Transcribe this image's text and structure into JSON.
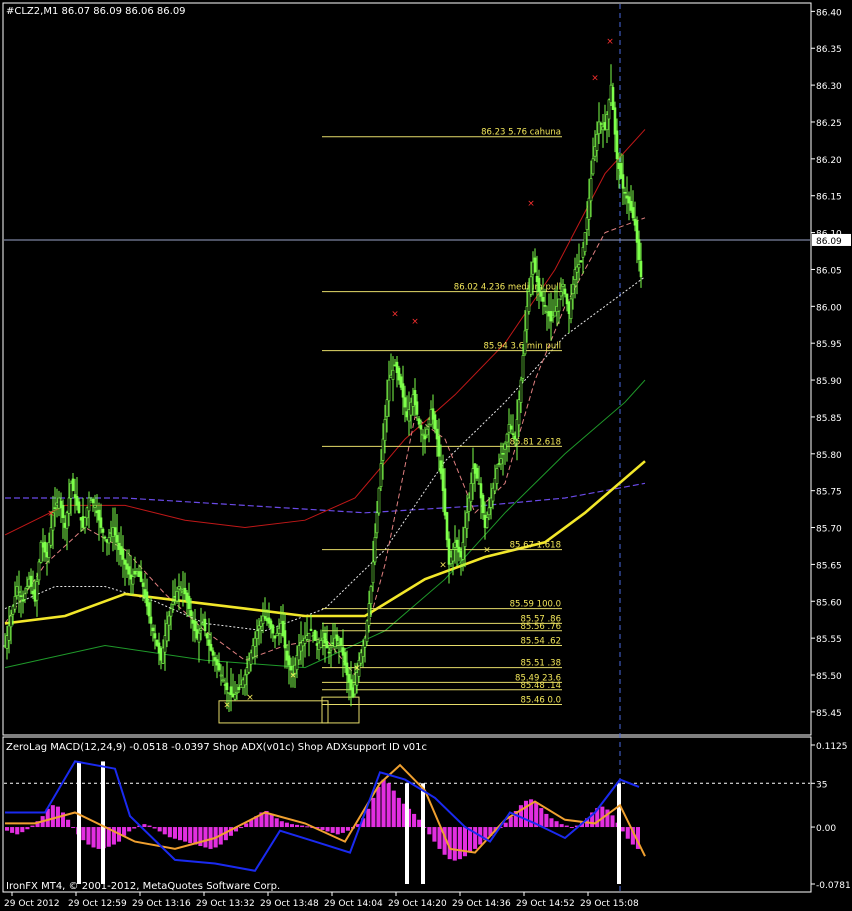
{
  "chart_data": {
    "type": "candlestick",
    "symbol_line": "#CLZ2,M1  86.07 86.09 86.06 86.09",
    "current_price": "86.09",
    "price_axis": {
      "ylim": [
        85.42,
        86.41
      ],
      "ticks": [
        "86.40",
        "86.35",
        "86.30",
        "86.25",
        "86.20",
        "86.15",
        "86.10",
        "86.05",
        "86.00",
        "85.95",
        "85.90",
        "85.85",
        "85.80",
        "85.75",
        "85.70",
        "85.65",
        "85.60",
        "85.55",
        "85.50",
        "85.45"
      ]
    },
    "time_axis": {
      "ticks": [
        "29 Oct 2012",
        "29 Oct 12:59",
        "29 Oct 13:16",
        "29 Oct 13:32",
        "29 Oct 13:48",
        "29 Oct 14:04",
        "29 Oct 14:20",
        "29 Oct 14:36",
        "29 Oct 14:52",
        "29 Oct 15:08"
      ]
    },
    "close_path": [
      [
        0,
        85.54
      ],
      [
        6,
        85.58
      ],
      [
        12,
        85.62
      ],
      [
        18,
        85.6
      ],
      [
        24,
        85.63
      ],
      [
        30,
        85.6
      ],
      [
        36,
        85.68
      ],
      [
        42,
        85.66
      ],
      [
        48,
        85.72
      ],
      [
        54,
        85.74
      ],
      [
        60,
        85.7
      ],
      [
        66,
        85.76
      ],
      [
        72,
        85.73
      ],
      [
        78,
        85.7
      ],
      [
        84,
        85.74
      ],
      [
        90,
        85.73
      ],
      [
        96,
        85.7
      ],
      [
        102,
        85.68
      ],
      [
        108,
        85.7
      ],
      [
        114,
        85.67
      ],
      [
        120,
        85.65
      ],
      [
        126,
        85.63
      ],
      [
        132,
        85.64
      ],
      [
        138,
        85.62
      ],
      [
        144,
        85.58
      ],
      [
        150,
        85.55
      ],
      [
        156,
        85.52
      ],
      [
        162,
        85.57
      ],
      [
        168,
        85.6
      ],
      [
        174,
        85.62
      ],
      [
        180,
        85.61
      ],
      [
        186,
        85.58
      ],
      [
        192,
        85.55
      ],
      [
        198,
        85.57
      ],
      [
        204,
        85.54
      ],
      [
        210,
        85.52
      ],
      [
        216,
        85.5
      ],
      [
        222,
        85.48
      ],
      [
        228,
        85.47
      ],
      [
        234,
        85.48
      ],
      [
        240,
        85.5
      ],
      [
        246,
        85.53
      ],
      [
        252,
        85.56
      ],
      [
        258,
        85.58
      ],
      [
        264,
        85.57
      ],
      [
        270,
        85.55
      ],
      [
        276,
        85.57
      ],
      [
        282,
        85.52
      ],
      [
        288,
        85.5
      ],
      [
        294,
        85.54
      ],
      [
        300,
        85.55
      ],
      [
        306,
        85.56
      ],
      [
        312,
        85.54
      ],
      [
        318,
        85.55
      ],
      [
        324,
        85.53
      ],
      [
        330,
        85.55
      ],
      [
        336,
        85.54
      ],
      [
        342,
        85.5
      ],
      [
        348,
        85.47
      ],
      [
        354,
        85.52
      ],
      [
        360,
        85.55
      ],
      [
        366,
        85.62
      ],
      [
        372,
        85.72
      ],
      [
        378,
        85.82
      ],
      [
        384,
        85.9
      ],
      [
        390,
        85.92
      ],
      [
        396,
        85.89
      ],
      [
        402,
        85.85
      ],
      [
        408,
        85.88
      ],
      [
        414,
        85.84
      ],
      [
        420,
        85.82
      ],
      [
        426,
        85.86
      ],
      [
        432,
        85.82
      ],
      [
        438,
        85.75
      ],
      [
        444,
        85.65
      ],
      [
        450,
        85.68
      ],
      [
        456,
        85.66
      ],
      [
        462,
        85.72
      ],
      [
        468,
        85.78
      ],
      [
        474,
        85.76
      ],
      [
        480,
        85.7
      ],
      [
        486,
        85.74
      ],
      [
        492,
        85.78
      ],
      [
        498,
        85.8
      ],
      [
        504,
        85.84
      ],
      [
        510,
        85.82
      ],
      [
        516,
        85.9
      ],
      [
        522,
        86.0
      ],
      [
        528,
        86.06
      ],
      [
        534,
        86.02
      ],
      [
        540,
        86.0
      ],
      [
        546,
        85.98
      ],
      [
        552,
        86.0
      ],
      [
        558,
        86.03
      ],
      [
        564,
        85.99
      ],
      [
        570,
        86.05
      ],
      [
        576,
        86.06
      ],
      [
        582,
        86.12
      ],
      [
        588,
        86.2
      ],
      [
        594,
        86.25
      ],
      [
        600,
        86.24
      ],
      [
        606,
        86.3
      ],
      [
        612,
        86.2
      ],
      [
        618,
        86.16
      ],
      [
        624,
        86.14
      ],
      [
        630,
        86.11
      ],
      [
        636,
        86.04
      ],
      [
        640,
        86.09
      ]
    ],
    "indicators": {
      "yellow_ma": [
        [
          0,
          85.57
        ],
        [
          60,
          85.58
        ],
        [
          120,
          85.61
        ],
        [
          180,
          85.6
        ],
        [
          240,
          85.59
        ],
        [
          300,
          85.58
        ],
        [
          360,
          85.58
        ],
        [
          420,
          85.63
        ],
        [
          480,
          85.66
        ],
        [
          540,
          85.68
        ],
        [
          580,
          85.72
        ],
        [
          640,
          85.79
        ]
      ],
      "purple_ma": [
        [
          0,
          85.74
        ],
        [
          120,
          85.74
        ],
        [
          240,
          85.73
        ],
        [
          360,
          85.72
        ],
        [
          480,
          85.73
        ],
        [
          560,
          85.74
        ],
        [
          640,
          85.76
        ]
      ],
      "red_ma": [
        [
          0,
          85.69
        ],
        [
          60,
          85.73
        ],
        [
          120,
          85.73
        ],
        [
          180,
          85.71
        ],
        [
          240,
          85.7
        ],
        [
          300,
          85.71
        ],
        [
          350,
          85.74
        ],
        [
          400,
          85.82
        ],
        [
          450,
          85.88
        ],
        [
          500,
          85.95
        ],
        [
          550,
          86.05
        ],
        [
          600,
          86.18
        ],
        [
          640,
          86.24
        ]
      ],
      "green_ma": [
        [
          0,
          85.51
        ],
        [
          100,
          85.54
        ],
        [
          200,
          85.52
        ],
        [
          300,
          85.51
        ],
        [
          380,
          85.56
        ],
        [
          440,
          85.63
        ],
        [
          500,
          85.72
        ],
        [
          560,
          85.8
        ],
        [
          620,
          85.87
        ],
        [
          640,
          85.9
        ]
      ],
      "white_dash_ma": [
        [
          0,
          85.59
        ],
        [
          50,
          85.62
        ],
        [
          100,
          85.62
        ],
        [
          150,
          85.6
        ],
        [
          200,
          85.57
        ],
        [
          260,
          85.56
        ],
        [
          320,
          85.59
        ],
        [
          380,
          85.67
        ],
        [
          440,
          85.79
        ],
        [
          500,
          85.87
        ],
        [
          560,
          85.96
        ],
        [
          640,
          86.04
        ]
      ],
      "pink_dash_ma": [
        [
          0,
          85.57
        ],
        [
          40,
          85.65
        ],
        [
          80,
          85.7
        ],
        [
          120,
          85.67
        ],
        [
          160,
          85.61
        ],
        [
          200,
          85.56
        ],
        [
          240,
          85.52
        ],
        [
          280,
          85.54
        ],
        [
          320,
          85.55
        ],
        [
          350,
          85.5
        ],
        [
          380,
          85.65
        ],
        [
          410,
          85.85
        ],
        [
          440,
          85.82
        ],
        [
          470,
          85.72
        ],
        [
          500,
          85.76
        ],
        [
          530,
          85.9
        ],
        [
          560,
          86.0
        ],
        [
          600,
          86.1
        ],
        [
          640,
          86.12
        ]
      ]
    },
    "red_markers": [
      [
        46,
        85.72
      ],
      [
        390,
        85.99
      ],
      [
        410,
        85.98
      ],
      [
        526,
        86.14
      ],
      [
        590,
        86.31
      ],
      [
        605,
        86.36
      ]
    ],
    "yellow_markers": [
      [
        222,
        85.46
      ],
      [
        245,
        85.47
      ],
      [
        288,
        85.5
      ],
      [
        352,
        85.51
      ],
      [
        438,
        85.65
      ],
      [
        482,
        85.67
      ]
    ],
    "fib_levels": [
      {
        "price": 86.23,
        "label": "86.23   5.76  cahuna"
      },
      {
        "price": 86.02,
        "label": "86.02  4.236 medium pull"
      },
      {
        "price": 85.94,
        "label": "85.94  3.6    min pull"
      },
      {
        "price": 85.81,
        "label": "85.81   2.618"
      },
      {
        "price": 85.67,
        "label": "85.67   1.618"
      },
      {
        "price": 85.59,
        "label": "85.59   100.0"
      },
      {
        "price": 85.57,
        "label": "85.57   .86"
      },
      {
        "price": 85.56,
        "label": "85.56   .76"
      },
      {
        "price": 85.54,
        "label": "85.54   .62"
      },
      {
        "price": 85.51,
        "label": "85.51   .38"
      },
      {
        "price": 85.49,
        "label": "85.49  23.6"
      },
      {
        "price": 85.48,
        "label": "85.48   .14"
      },
      {
        "price": 85.46,
        "label": "85.46    0.0"
      }
    ],
    "macd_panel": {
      "title": "ZeroLag MACD(12,24,9) -0.0518 -0.0397  Shop ADX(v01c)  Shop ADXsupport ID v01c",
      "right_labels": [
        "0.1125",
        "35",
        "0.00",
        "-0.0781"
      ],
      "ylim": [
        -0.0781,
        0.1125
      ],
      "histogram": [
        -0.005,
        -0.008,
        -0.01,
        -0.007,
        -0.003,
        0.002,
        0.008,
        0.015,
        0.025,
        0.03,
        0.028,
        0.02,
        0.01,
        0.0,
        -0.01,
        -0.018,
        -0.024,
        -0.028,
        -0.03,
        -0.029,
        -0.027,
        -0.024,
        -0.02,
        -0.012,
        -0.006,
        -0.002,
        0.002,
        0.004,
        0.002,
        -0.002,
        -0.006,
        -0.01,
        -0.014,
        -0.016,
        -0.018,
        -0.02,
        -0.022,
        -0.024,
        -0.026,
        -0.028,
        -0.03,
        -0.028,
        -0.024,
        -0.018,
        -0.012,
        -0.006,
        0.0,
        0.005,
        0.01,
        0.015,
        0.02,
        0.022,
        0.018,
        0.012,
        0.008,
        0.006,
        0.004,
        0.003,
        0.002,
        0.001,
        0.0,
        -0.002,
        -0.004,
        -0.006,
        -0.008,
        -0.01,
        -0.008,
        -0.005,
        -0.002,
        0.004,
        0.012,
        0.025,
        0.04,
        0.055,
        0.065,
        0.06,
        0.05,
        0.04,
        0.032,
        0.025,
        0.018,
        0.01,
        0.0,
        -0.01,
        -0.02,
        -0.03,
        -0.038,
        -0.044,
        -0.046,
        -0.044,
        -0.04,
        -0.035,
        -0.03,
        -0.024,
        -0.018,
        -0.012,
        -0.006,
        0.0,
        0.006,
        0.014,
        0.022,
        0.03,
        0.036,
        0.038,
        0.034,
        0.026,
        0.018,
        0.012,
        0.008,
        0.004,
        0.002,
        0.0,
        0.002,
        0.006,
        0.012,
        0.02,
        0.026,
        0.028,
        0.024,
        0.016,
        0.006,
        -0.006,
        -0.016,
        -0.024,
        -0.03
      ],
      "signal_line": [
        [
          0,
          0.005
        ],
        [
          30,
          0.005
        ],
        [
          70,
          0.02
        ],
        [
          100,
          0.0
        ],
        [
          130,
          -0.02
        ],
        [
          170,
          -0.03
        ],
        [
          210,
          -0.015
        ],
        [
          260,
          0.02
        ],
        [
          300,
          0.005
        ],
        [
          340,
          -0.02
        ],
        [
          375,
          0.06
        ],
        [
          395,
          0.085
        ],
        [
          420,
          0.05
        ],
        [
          445,
          -0.03
        ],
        [
          470,
          -0.035
        ],
        [
          500,
          0.01
        ],
        [
          530,
          0.035
        ],
        [
          560,
          0.01
        ],
        [
          590,
          0.005
        ],
        [
          615,
          0.03
        ],
        [
          640,
          -0.04
        ]
      ],
      "adx_line": [
        [
          0,
          0.02
        ],
        [
          40,
          0.02
        ],
        [
          70,
          0.09
        ],
        [
          110,
          0.08
        ],
        [
          125,
          0.015
        ],
        [
          170,
          -0.045
        ],
        [
          210,
          -0.05
        ],
        [
          250,
          -0.06
        ],
        [
          275,
          -0.005
        ],
        [
          310,
          -0.02
        ],
        [
          345,
          -0.035
        ],
        [
          375,
          0.075
        ],
        [
          400,
          0.065
        ],
        [
          430,
          0.04
        ],
        [
          460,
          0.0
        ],
        [
          485,
          -0.02
        ],
        [
          505,
          0.02
        ],
        [
          530,
          0.005
        ],
        [
          560,
          -0.015
        ],
        [
          590,
          0.02
        ],
        [
          615,
          0.065
        ],
        [
          634,
          0.055
        ]
      ],
      "white_bars": [
        [
          74,
          0.09
        ],
        [
          98,
          0.09
        ],
        [
          402,
          0.06
        ],
        [
          418,
          0.06
        ],
        [
          614,
          0.06
        ]
      ],
      "level_35": 0.06
    },
    "footer": "IronFX MT4, © 2001-2012, MetaQuotes Software Corp."
  }
}
